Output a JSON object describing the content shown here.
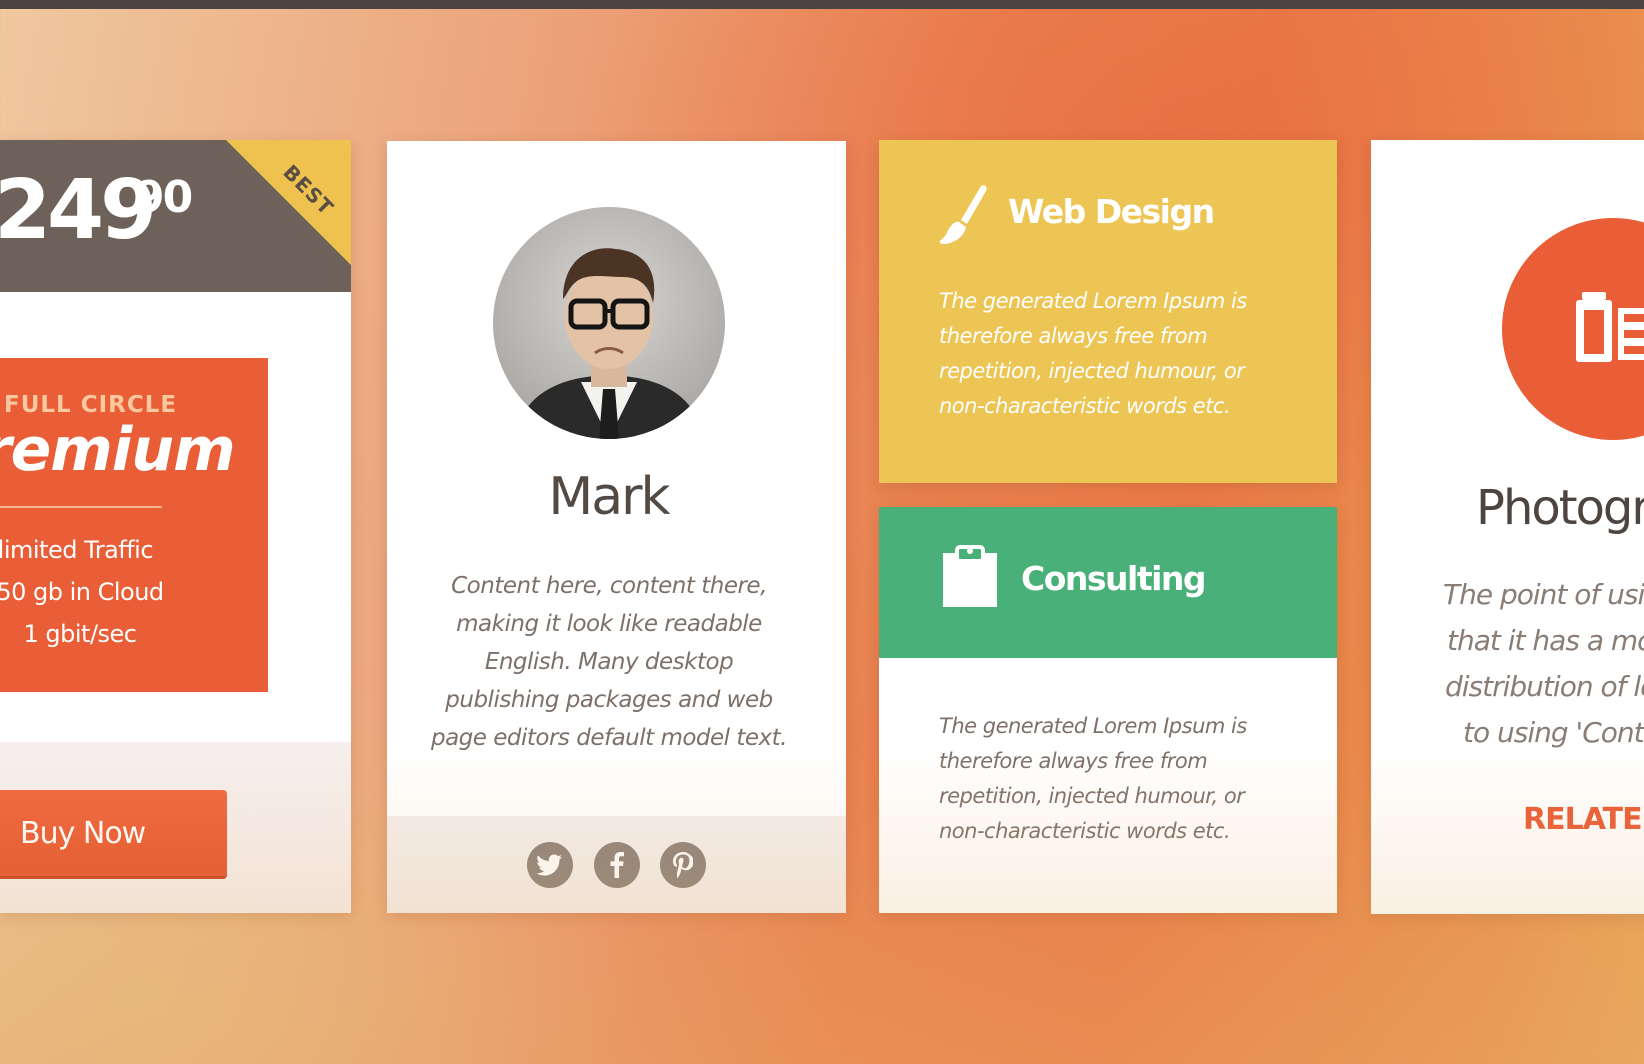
{
  "pricing": {
    "badge": "BEST",
    "price_main": "249",
    "price_cents": "90",
    "plan_kicker": "FULL CIRCLE",
    "plan_name": "remium",
    "features": [
      "nlimited Traffic",
      "50 gb in Cloud",
      "1 gbit/sec"
    ],
    "button_label": "Buy Now"
  },
  "profile": {
    "name": "Mark",
    "bio": "Content here, content there, making it look like readable English. Many desktop publishing packages and web page editors default model text.",
    "social": [
      "twitter-icon",
      "facebook-icon",
      "pinterest-icon"
    ]
  },
  "services": {
    "web_design": {
      "title": "Web Design",
      "icon": "paintbrush-icon",
      "text": "The generated Lorem Ipsum is therefore always free from repetition, injected humour, or non-characteristic words etc."
    },
    "consulting": {
      "title": "Consulting",
      "icon": "clipboard-icon",
      "text": "The generated Lorem Ipsum is therefore always free from repetition, injected humour, or non-characteristic words etc."
    }
  },
  "photography": {
    "title": "Photogr",
    "icon": "film-icon",
    "lines": [
      "The point of usin",
      "that it has a mo",
      "distribution of le",
      "to using 'Conte"
    ],
    "link": "RELATED"
  },
  "colors": {
    "accent_orange": "#e95d37",
    "accent_yellow": "#edc555",
    "accent_green": "#48b078",
    "dark_brown": "#6d6159"
  }
}
